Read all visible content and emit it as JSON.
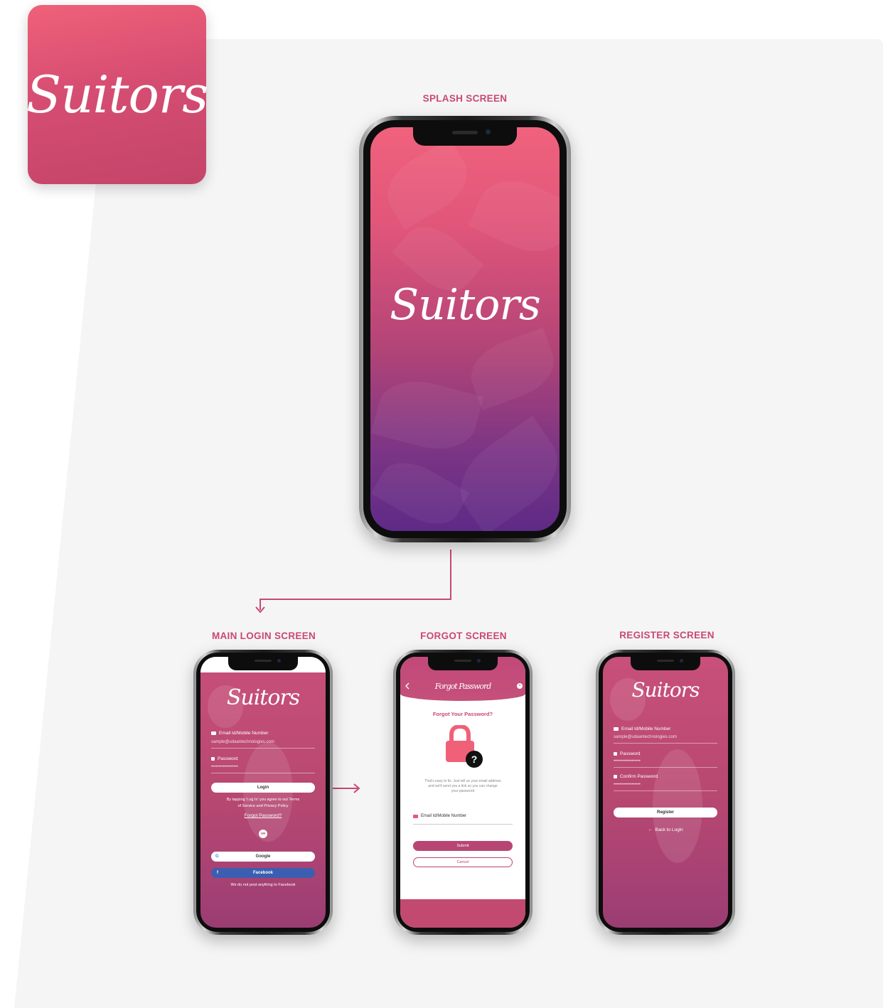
{
  "app_icon": {
    "logo": "Suitors"
  },
  "splash": {
    "title": "SPLASH SCREEN",
    "logo": "Suitors"
  },
  "login": {
    "title": "MAIN LOGIN SCREEN",
    "logo": "Suitors",
    "email_label": "Email Id/Mobile Number",
    "email_value": "sample@udaantechnologies.com",
    "password_label": "Password",
    "password_value": "••••••••••••••••••",
    "login_button": "Login",
    "terms_line1": "By tapping 'Log In' you agree to out Terms",
    "terms_line2": "of Service and Privacy Policy",
    "forgot_link": "Forgot Password?",
    "or_label": "OR",
    "google_button": "Google",
    "facebook_button": "Facebook",
    "facebook_note": "We do not post anything to Facebook"
  },
  "forgot": {
    "title": "FORGOT SCREEN",
    "header_title": "Forgot Password",
    "heading": "Forgot Your Password?",
    "desc_line1": "That's easy to fix. Just tell us your email address",
    "desc_line2": "and we'll send you a link so you can change",
    "desc_line3": "your password",
    "email_label": "Email Id/Mobile Number",
    "submit_button": "Submit",
    "cancel_button": "Cancel"
  },
  "register": {
    "title": "REGISTER SCREEN",
    "logo": "Suitors",
    "email_label": "Email Id/Mobile Number",
    "email_value": "sample@udaantechnologies.com",
    "password_label": "Password",
    "password_value": "••••••••••••••••••",
    "confirm_label": "Confirm Password",
    "confirm_value": "••••••••••••••••••",
    "register_button": "Register",
    "back_link": "Back to Login"
  },
  "colors": {
    "accent": "#c94872",
    "brand_pink": "#f06179",
    "brand_purple": "#5e2a86"
  }
}
